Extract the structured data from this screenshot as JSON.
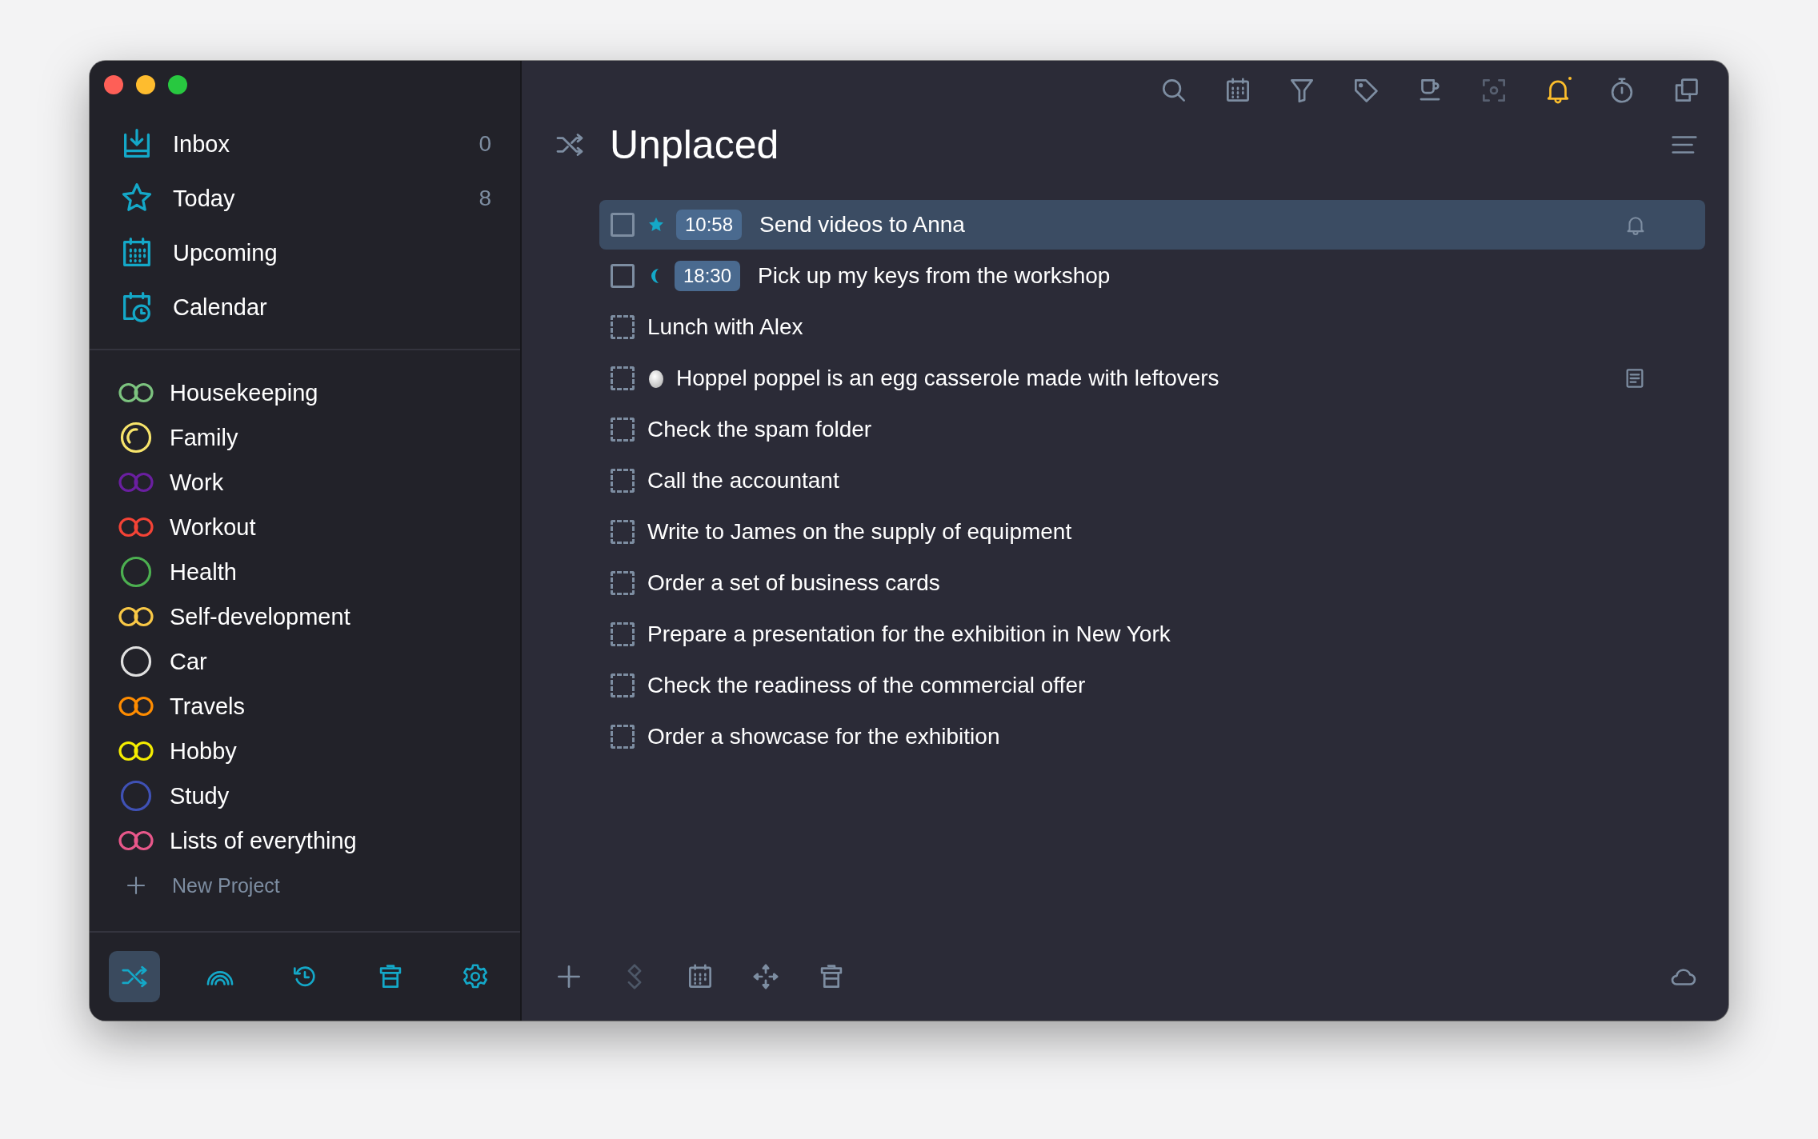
{
  "window": {
    "controls": [
      {
        "kind": "close"
      },
      {
        "kind": "minimize"
      },
      {
        "kind": "zoom"
      }
    ]
  },
  "sidebar": {
    "nav_items": [
      {
        "kind": "inbox",
        "label": "Inbox",
        "count": "0"
      },
      {
        "kind": "today",
        "label": "Today",
        "count": "8"
      },
      {
        "kind": "upcoming",
        "label": "Upcoming"
      },
      {
        "kind": "calendar",
        "label": "Calendar"
      }
    ],
    "projects": [
      {
        "kind": "double",
        "name": "Housekeeping",
        "color": "#7cc37f"
      },
      {
        "kind": "partial",
        "name": "Family",
        "color": "#f7e46b"
      },
      {
        "kind": "double",
        "name": "Work",
        "color": "#6a1fa0"
      },
      {
        "kind": "double",
        "name": "Workout",
        "color": "#f44336"
      },
      {
        "kind": "single",
        "name": "Health",
        "color": "#4caf50"
      },
      {
        "kind": "double",
        "name": "Self-development",
        "color": "#f9c846"
      },
      {
        "kind": "single",
        "name": "Car",
        "color": "#e0e0e0"
      },
      {
        "kind": "double",
        "name": "Travels",
        "color": "#ff8c00"
      },
      {
        "kind": "double",
        "name": "Hobby",
        "color": "#f5ed00"
      },
      {
        "kind": "single",
        "name": "Study",
        "color": "#3f51b5"
      },
      {
        "kind": "double",
        "name": "Lists of everything",
        "color": "#e8578a"
      }
    ],
    "new_project": "New Project",
    "bottom_bar": [
      {
        "kind": "shuffle",
        "selected": true
      },
      {
        "kind": "rainbow",
        "selected": false
      },
      {
        "kind": "history",
        "selected": false
      },
      {
        "kind": "trash",
        "selected": false
      },
      {
        "kind": "settings",
        "selected": false
      }
    ]
  },
  "toolbar": [
    {
      "kind": "search",
      "active": false,
      "disabled": false
    },
    {
      "kind": "calendar",
      "active": false,
      "disabled": false
    },
    {
      "kind": "filter",
      "active": false,
      "disabled": false
    },
    {
      "kind": "tag",
      "active": false,
      "disabled": false
    },
    {
      "kind": "cup",
      "active": false,
      "disabled": false
    },
    {
      "kind": "focus",
      "active": false,
      "disabled": true
    },
    {
      "kind": "bell",
      "active": true,
      "disabled": false
    },
    {
      "kind": "timer",
      "active": false,
      "disabled": false
    },
    {
      "kind": "copy",
      "active": false,
      "disabled": false
    }
  ],
  "header": {
    "title": "Unplaced"
  },
  "tasks": [
    {
      "kind": "timed",
      "selected": true,
      "marker": {
        "kind": "star"
      },
      "time": "10:58",
      "title": "Send videos to Anna",
      "reminder": true,
      "note": false
    },
    {
      "kind": "timed",
      "selected": false,
      "marker": {
        "kind": "moon"
      },
      "time": "18:30",
      "title": "Pick up my keys from the workshop",
      "reminder": false,
      "note": false
    },
    {
      "kind": "plain",
      "selected": false,
      "title": "Lunch with Alex",
      "reminder": false,
      "note": false
    },
    {
      "kind": "plain",
      "selected": false,
      "marker": {
        "kind": "egg"
      },
      "title": "Hoppel poppel is an egg casserole made with leftovers",
      "reminder": false,
      "note": true
    },
    {
      "kind": "plain",
      "selected": false,
      "title": "Check the spam folder",
      "reminder": false,
      "note": false
    },
    {
      "kind": "plain",
      "selected": false,
      "title": "Call the accountant",
      "reminder": false,
      "note": false
    },
    {
      "kind": "plain",
      "selected": false,
      "title": "Write to James on the supply of equipment",
      "reminder": false,
      "note": false
    },
    {
      "kind": "plain",
      "selected": false,
      "title": "Order a set of business cards",
      "reminder": false,
      "note": false
    },
    {
      "kind": "plain",
      "selected": false,
      "title": "Prepare a presentation for the exhibition in New York",
      "reminder": false,
      "note": false
    },
    {
      "kind": "plain",
      "selected": false,
      "title": "Check the readiness of the commercial offer",
      "reminder": false,
      "note": false
    },
    {
      "kind": "plain",
      "selected": false,
      "title": "Order a showcase for the exhibition",
      "reminder": false,
      "note": false
    }
  ],
  "bottom_bar": [
    {
      "kind": "add",
      "disabled": false
    },
    {
      "kind": "layers",
      "disabled": true
    },
    {
      "kind": "calendar",
      "disabled": false
    },
    {
      "kind": "move",
      "disabled": false
    },
    {
      "kind": "trash",
      "disabled": false
    },
    {
      "kind": "cloud",
      "disabled": false
    }
  ]
}
